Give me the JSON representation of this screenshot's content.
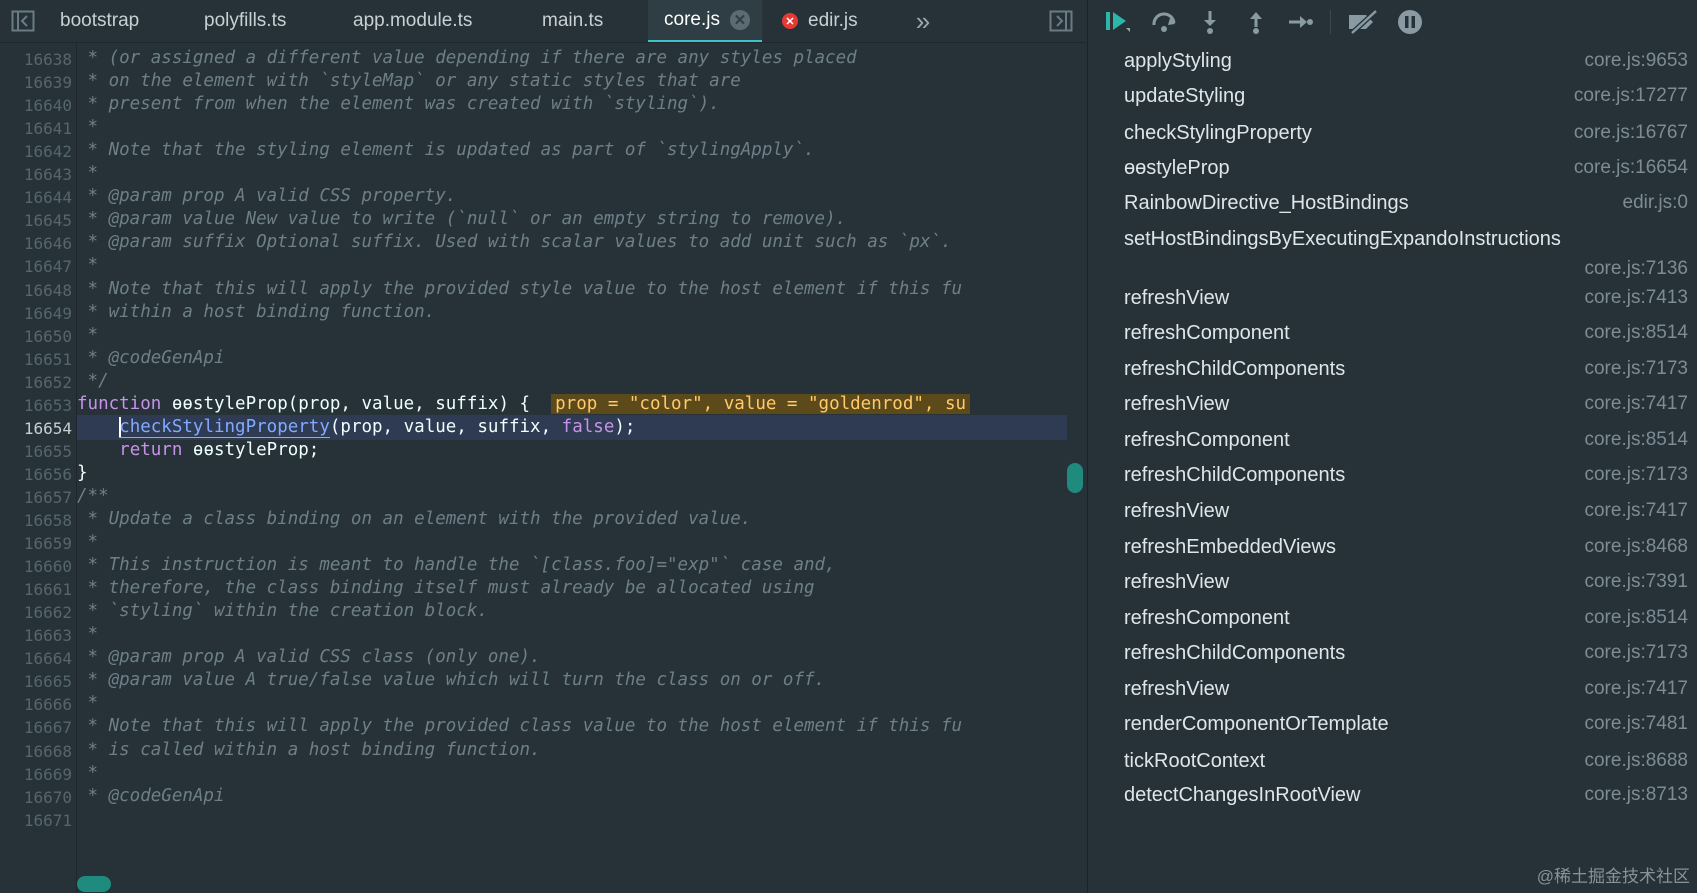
{
  "tabs": [
    {
      "label": "bootstrap"
    },
    {
      "label": "polyfills.ts"
    },
    {
      "label": "app.module.ts"
    },
    {
      "label": "main.ts"
    },
    {
      "label": "core.js",
      "active": true
    },
    {
      "label": "edir.js",
      "error": true
    }
  ],
  "icons": {
    "sidebar_toggle": "sidebar-toggle-icon",
    "close": "close-icon",
    "error": "error-icon",
    "overflow": "chevron-double-right-icon",
    "panel_toggle": "panel-toggle-icon"
  },
  "close_glyph": "✕",
  "overflow_glyph": "»",
  "editor": {
    "lines": [
      {
        "num": "16638",
        "text": " * (or assigned a different value depending if there are any styles placed"
      },
      {
        "num": "16639",
        "text": " * on the element with `styleMap` or any static styles that are"
      },
      {
        "num": "16640",
        "text": " * present from when the element was created with `styling`)."
      },
      {
        "num": "16641",
        "text": " *"
      },
      {
        "num": "16642",
        "text": " * Note that the styling element is updated as part of `stylingApply`."
      },
      {
        "num": "16643",
        "text": " *"
      },
      {
        "num": "16644",
        "text": " * @param prop A valid CSS property."
      },
      {
        "num": "16645",
        "text": " * @param value New value to write (`null` or an empty string to remove)."
      },
      {
        "num": "16646",
        "text": " * @param suffix Optional suffix. Used with scalar values to add unit such as `px`."
      },
      {
        "num": "16647",
        "text": " *"
      },
      {
        "num": "16648",
        "text": " * Note that this will apply the provided style value to the host element if this fu"
      },
      {
        "num": "16649",
        "text": " * within a host binding function."
      },
      {
        "num": "16650",
        "text": " *"
      },
      {
        "num": "16651",
        "text": " * @codeGenApi"
      },
      {
        "num": "16652",
        "text": " */"
      },
      {
        "num": "16653",
        "keyword": "function",
        "signature": " ɵɵstyleProp(prop, value, suffix) {",
        "inline_value": "prop = \"color\", value = \"goldenrod\", su"
      },
      {
        "num": "16654",
        "indent": "    ",
        "call": "checkStylingProperty",
        "args": "(prop, value, suffix, ",
        "bool": "false",
        "tail": ");"
      },
      {
        "num": "16655",
        "indent": "    ",
        "keyword": "return",
        "rest": " ɵɵstyleProp;"
      },
      {
        "num": "16656",
        "text": "}"
      },
      {
        "num": "16657",
        "text": "/**"
      },
      {
        "num": "16658",
        "text": " * Update a class binding on an element with the provided value."
      },
      {
        "num": "16659",
        "text": " *"
      },
      {
        "num": "16660",
        "text": " * This instruction is meant to handle the `[class.foo]=\"exp\"` case and,"
      },
      {
        "num": "16661",
        "text": " * therefore, the class binding itself must already be allocated using"
      },
      {
        "num": "16662",
        "text": " * `styling` within the creation block."
      },
      {
        "num": "16663",
        "text": " *"
      },
      {
        "num": "16664",
        "text": " * @param prop A valid CSS class (only one)."
      },
      {
        "num": "16665",
        "text": " * @param value A true/false value which will turn the class on or off."
      },
      {
        "num": "16666",
        "text": " *"
      },
      {
        "num": "16667",
        "text": " * Note that this will apply the provided class value to the host element if this fu"
      },
      {
        "num": "16668",
        "text": " * is called within a host binding function."
      },
      {
        "num": "16669",
        "text": " *"
      },
      {
        "num": "16670",
        "text": " * @codeGenApi"
      },
      {
        "num": "16671",
        "text": ""
      }
    ]
  },
  "debugger": {
    "toolbar": [
      {
        "name": "resume-button",
        "icon": "resume-icon"
      },
      {
        "name": "step-over-button",
        "icon": "step-over-icon"
      },
      {
        "name": "step-into-button",
        "icon": "step-into-icon"
      },
      {
        "name": "step-out-button",
        "icon": "step-out-icon"
      },
      {
        "name": "step-button",
        "icon": "step-icon"
      },
      {
        "name": "deactivate-breakpoints-button",
        "icon": "breakpoints-off-icon"
      },
      {
        "name": "pause-on-exceptions-button",
        "icon": "pause-icon"
      }
    ],
    "call_stack": [
      {
        "name": "applyStyling",
        "location": "core.js:9653"
      },
      {
        "name": "updateStyling",
        "location": "core.js:17277"
      },
      {
        "name": "checkStylingProperty",
        "location": "core.js:16767"
      },
      {
        "name": "ɵɵstyleProp",
        "location": "core.js:16654"
      },
      {
        "name": "RainbowDirective_HostBindings",
        "location": "edir.js:0"
      },
      {
        "name": "setHostBindingsByExecutingExpandoInstructions",
        "location": "core.js:7136",
        "wrap": true
      },
      {
        "name": "refreshView",
        "location": "core.js:7413"
      },
      {
        "name": "refreshComponent",
        "location": "core.js:8514"
      },
      {
        "name": "refreshChildComponents",
        "location": "core.js:7173"
      },
      {
        "name": "refreshView",
        "location": "core.js:7417"
      },
      {
        "name": "refreshComponent",
        "location": "core.js:8514"
      },
      {
        "name": "refreshChildComponents",
        "location": "core.js:7173"
      },
      {
        "name": "refreshView",
        "location": "core.js:7417"
      },
      {
        "name": "refreshEmbeddedViews",
        "location": "core.js:8468"
      },
      {
        "name": "refreshView",
        "location": "core.js:7391"
      },
      {
        "name": "refreshComponent",
        "location": "core.js:8514"
      },
      {
        "name": "refreshChildComponents",
        "location": "core.js:7173"
      },
      {
        "name": "refreshView",
        "location": "core.js:7417"
      },
      {
        "name": "renderComponentOrTemplate",
        "location": "core.js:7481"
      },
      {
        "name": "tickRootContext",
        "location": "core.js:8688"
      },
      {
        "name": "detectChangesInRootView",
        "location": "core.js:8713"
      }
    ]
  },
  "watermark": "@稀土掘金技术社区"
}
